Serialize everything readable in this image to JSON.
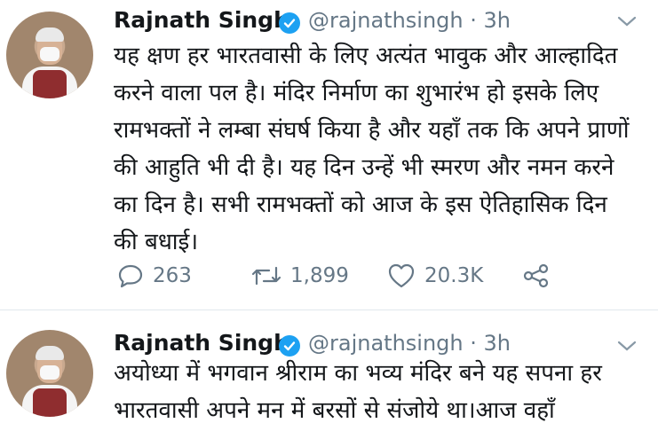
{
  "tweets": [
    {
      "name": "Rajnath Singh",
      "handle": "@rajnathsingh · 3h",
      "text": "यह क्षण हर भारतवासी के लिए अत्यंत भावुक और आल्हादित करने वाला पल है। मंदिर निर्माण का शुभारंभ हो इसके लिए रामभक्तों ने लम्बा संघर्ष किया है और यहाँ तक कि अपने प्राणों की आहुति भी दी है। यह दिन उन्हें भी स्मरण और नमन करने का दिन है। सभी रामभक्तों को आज के इस ऐतिहासिक दिन की बधाई।",
      "replies": "263",
      "retweets": "1,899",
      "likes": "20.3K"
    },
    {
      "name": "Rajnath Singh",
      "handle": "@rajnathsingh · 3h",
      "text": "अयोध्या में भगवान श्रीराम का भव्य मंदिर बने यह सपना हर भारतवासी अपने मन में बरसों से संजोये था।आज वहाँ"
    }
  ],
  "icons": {
    "verified": "verified-badge-icon",
    "chevron": "chevron-down-icon",
    "reply": "reply-icon",
    "retweet": "retweet-icon",
    "like": "heart-icon",
    "share": "share-icon"
  },
  "colors": {
    "verified": "#1da1f2",
    "meta": "#657786",
    "text": "#14171a"
  }
}
